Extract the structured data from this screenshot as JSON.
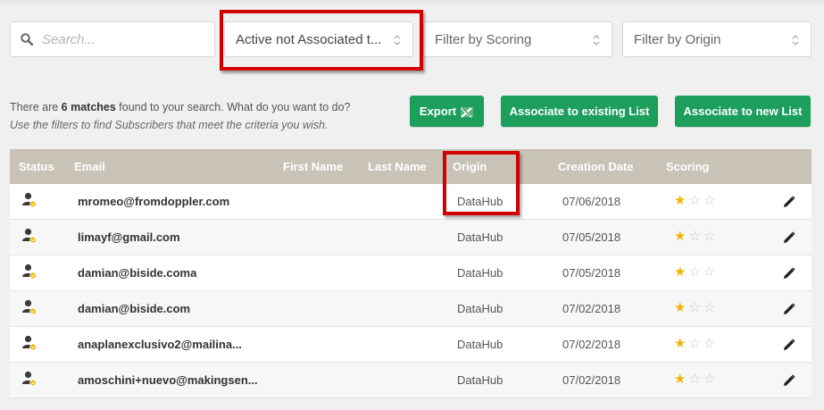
{
  "search": {
    "placeholder": "Search..."
  },
  "filters": {
    "status": "Active not Associated t...",
    "scoring": "Filter by Scoring",
    "origin": "Filter by Origin"
  },
  "info": {
    "prefix": "There are ",
    "count": "6 matches",
    "suffix": " found to your search. What do you want to do?",
    "hint": "Use the filters to find Subscribers that meet the criteria you wish."
  },
  "actions": {
    "export": "Export",
    "associate_existing": "Associate to existing List",
    "associate_new": "Associate to new List"
  },
  "table": {
    "headers": {
      "status": "Status",
      "email": "Email",
      "first_name": "First Name",
      "last_name": "Last Name",
      "origin": "Origin",
      "creation_date": "Creation Date",
      "scoring": "Scoring"
    },
    "rows": [
      {
        "email": "mromeo@fromdoppler.com",
        "origin": "DataHub",
        "date": "07/06/2018",
        "score": 1
      },
      {
        "email": "limayf@gmail.com",
        "origin": "DataHub",
        "date": "07/05/2018",
        "score": 1
      },
      {
        "email": "damian@biside.coma",
        "origin": "DataHub",
        "date": "07/05/2018",
        "score": 1
      },
      {
        "email": "damian@biside.com",
        "origin": "DataHub",
        "date": "07/02/2018",
        "score": 1
      },
      {
        "email": "anaplanexclusivo2@mailina...",
        "origin": "DataHub",
        "date": "07/02/2018",
        "score": 1
      },
      {
        "email": "amoschini+nuevo@makingsen...",
        "origin": "DataHub",
        "date": "07/02/2018",
        "score": 1
      }
    ]
  },
  "colors": {
    "accent_green": "#1c9e5c",
    "header_bg": "#c8c3b6",
    "highlight_red": "#d10000",
    "star_on": "#f0b400"
  }
}
